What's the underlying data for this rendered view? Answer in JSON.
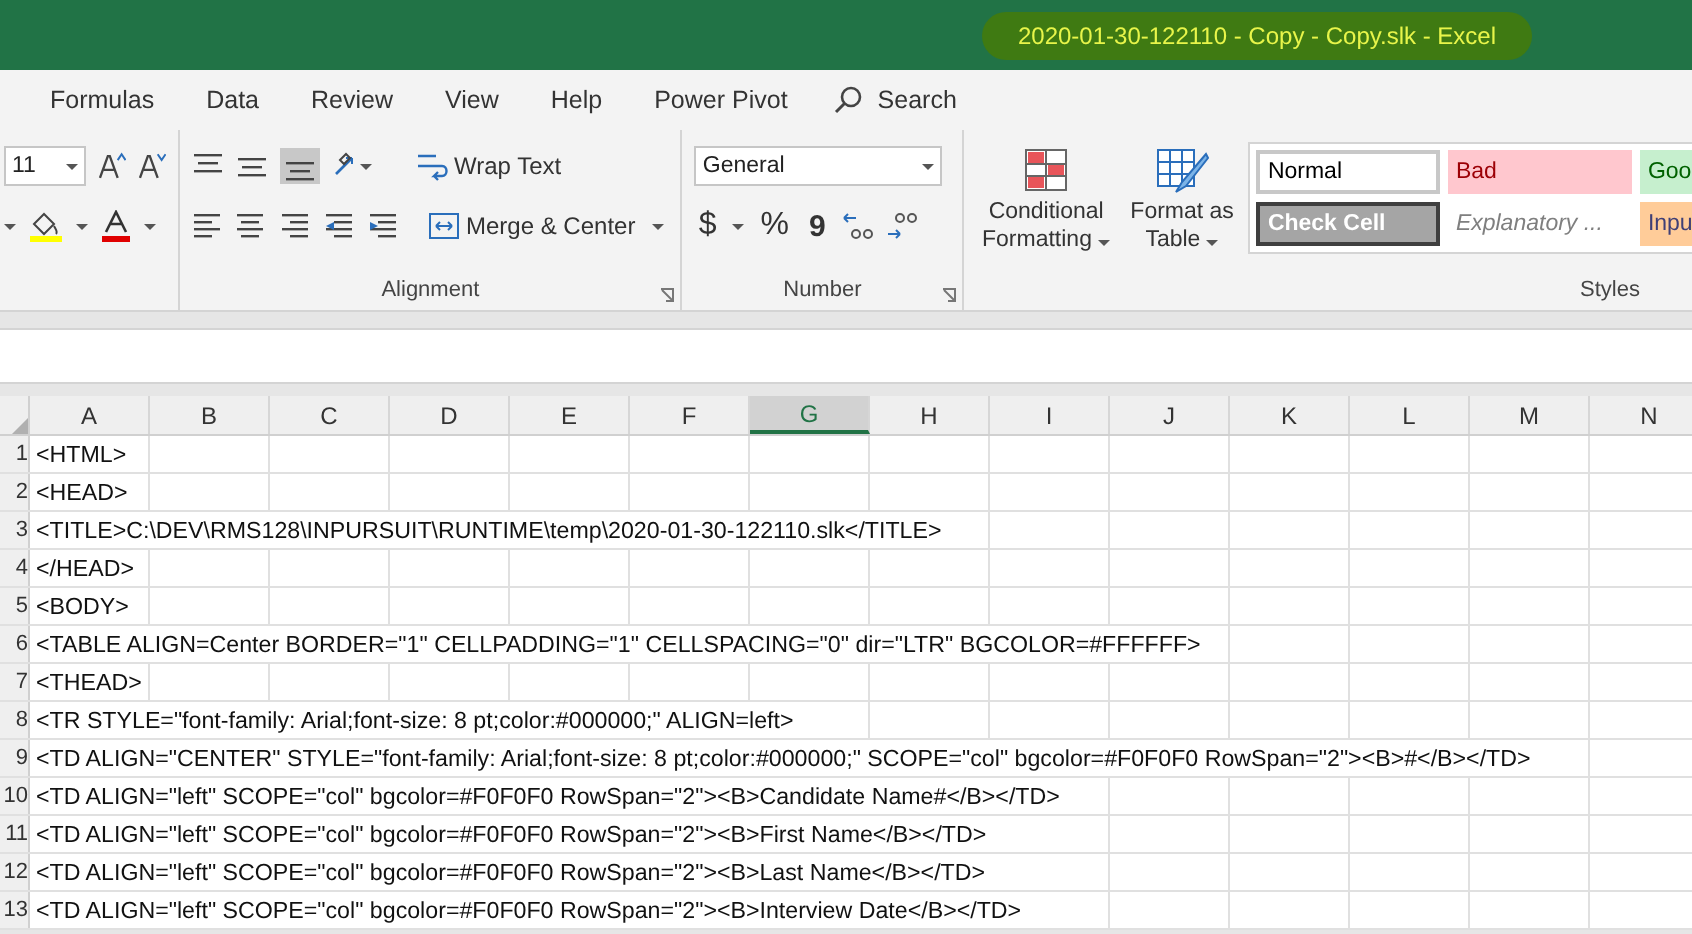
{
  "window": {
    "title": "2020-01-30-122110 - Copy - Copy.slk  -  Excel"
  },
  "menu_tabs": [
    {
      "label": "Formulas",
      "selected": false
    },
    {
      "label": "Data",
      "selected": false
    },
    {
      "label": "Review",
      "selected": false
    },
    {
      "label": "View",
      "selected": false
    },
    {
      "label": "Help",
      "selected": false
    },
    {
      "label": "Power Pivot",
      "selected": false
    }
  ],
  "search": {
    "placeholder": "Search"
  },
  "ribbon": {
    "font": {
      "size": "11"
    },
    "alignment": {
      "label": "Alignment",
      "wrap_text": "Wrap Text",
      "merge_center": "Merge & Center",
      "bottom_align_selected": true
    },
    "number": {
      "label": "Number",
      "format": "General",
      "currency": "$",
      "percent": "%",
      "comma": "9"
    },
    "styles": {
      "label": "Styles",
      "conditional": [
        "Conditional",
        "Formatting"
      ],
      "format_table": [
        "Format as",
        "Table"
      ],
      "cells": [
        {
          "label": "Normal",
          "kind": "normal"
        },
        {
          "label": "Bad",
          "kind": "bad"
        },
        {
          "label": "Goo",
          "kind": "good"
        },
        {
          "label": "Check Cell",
          "kind": "check"
        },
        {
          "label": "Explanatory ...",
          "kind": "explanatory"
        },
        {
          "label": "Inpu",
          "kind": "input"
        }
      ]
    }
  },
  "sheet": {
    "columns": [
      {
        "label": "A",
        "selected": false
      },
      {
        "label": "B",
        "selected": false
      },
      {
        "label": "C",
        "selected": false
      },
      {
        "label": "D",
        "selected": false
      },
      {
        "label": "E",
        "selected": false
      },
      {
        "label": "F",
        "selected": false
      },
      {
        "label": "G",
        "selected": true
      },
      {
        "label": "H",
        "selected": false
      },
      {
        "label": "I",
        "selected": false
      },
      {
        "label": "J",
        "selected": false
      },
      {
        "label": "K",
        "selected": false
      },
      {
        "label": "L",
        "selected": false
      },
      {
        "label": "M",
        "selected": false
      },
      {
        "label": "N",
        "selected": false
      }
    ],
    "rows": [
      {
        "number": "1",
        "text": "<HTML>"
      },
      {
        "number": "2",
        "text": "<HEAD>"
      },
      {
        "number": "3",
        "text": "<TITLE>C:\\DEV\\RMS128\\INPURSUIT\\RUNTIME\\temp\\2020-01-30-122110.slk</TITLE>"
      },
      {
        "number": "4",
        "text": "</HEAD>"
      },
      {
        "number": "5",
        "text": "<BODY>"
      },
      {
        "number": "6",
        "text": "<TABLE ALIGN=Center BORDER=\"1\" CELLPADDING=\"1\" CELLSPACING=\"0\" dir=\"LTR\" BGCOLOR=#FFFFFF>"
      },
      {
        "number": "7",
        "text": "<THEAD>"
      },
      {
        "number": "8",
        "text": "<TR STYLE=\"font-family: Arial;font-size: 8 pt;color:#000000;\" ALIGN=left>"
      },
      {
        "number": "9",
        "text": "<TD ALIGN=\"CENTER\" STYLE=\"font-family: Arial;font-size: 8 pt;color:#000000;\" SCOPE=\"col\" bgcolor=#F0F0F0 RowSpan=\"2\"><B>#</B></TD>"
      },
      {
        "number": "10",
        "text": "<TD ALIGN=\"left\" SCOPE=\"col\" bgcolor=#F0F0F0 RowSpan=\"2\"><B>Candidate Name#</B></TD>"
      },
      {
        "number": "11",
        "text": "<TD ALIGN=\"left\" SCOPE=\"col\" bgcolor=#F0F0F0 RowSpan=\"2\"><B>First Name</B></TD>"
      },
      {
        "number": "12",
        "text": "<TD ALIGN=\"left\" SCOPE=\"col\" bgcolor=#F0F0F0 RowSpan=\"2\"><B>Last Name</B></TD>"
      },
      {
        "number": "13",
        "text": "<TD ALIGN=\"left\" SCOPE=\"col\" bgcolor=#F0F0F0 RowSpan=\"2\"><B>Interview Date</B></TD>"
      }
    ]
  }
}
